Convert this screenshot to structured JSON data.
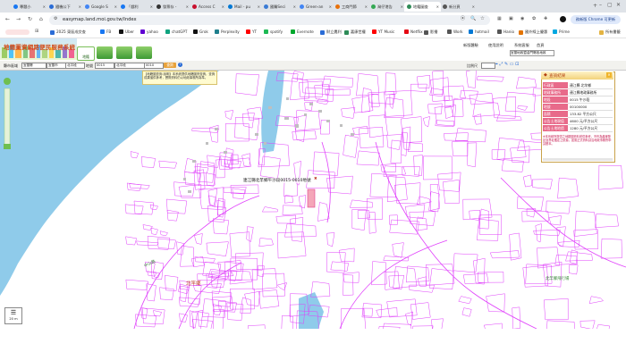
{
  "browser": {
    "tabs": [
      {
        "label": "專題小",
        "color": "#1877f2"
      },
      {
        "label": "隨機公下",
        "color": "#2a6cd6"
      },
      {
        "label": "Google S",
        "color": "#4285f4"
      },
      {
        "label": "「戲利",
        "color": "#1877f2"
      },
      {
        "label": "發票存 - ",
        "color": "#333333"
      },
      {
        "label": "Access C",
        "color": "#c8102e"
      },
      {
        "label": "Mail - pu",
        "color": "#0078d4"
      },
      {
        "label": "國醫Seci",
        "color": "#3a7bd5"
      },
      {
        "label": "Green-an",
        "color": "#4285f4"
      },
      {
        "label": "工商門節",
        "color": "#e8710a"
      },
      {
        "label": "灣仔港告",
        "color": "#34a853"
      },
      {
        "label": "地籍圖查",
        "color": "#2e8b57"
      },
      {
        "label": "新分頁",
        "color": "#555555"
      }
    ],
    "active_tab_index": 11,
    "url": "easymap.land.moi.gov.tw/Index",
    "update_button": "務新版 Chrome 可更新",
    "bookmarks": [
      {
        "label": "2025 東區成交查",
        "color": "#2a6cd6"
      },
      {
        "label": "FB",
        "color": "#1877f2"
      },
      {
        "label": "Uber",
        "color": "#111111"
      },
      {
        "label": "yahoo",
        "color": "#6001d2"
      },
      {
        "label": "chatGPT",
        "color": "#10a37f"
      },
      {
        "label": "Grok",
        "color": "#111111"
      },
      {
        "label": "Perplexity",
        "color": "#20808d"
      },
      {
        "label": "YT",
        "color": "#ff0000"
      },
      {
        "label": "spotify",
        "color": "#1db954"
      },
      {
        "label": "Evernote",
        "color": "#00a82d"
      },
      {
        "label": "財立農利",
        "color": "#2a6cd6"
      },
      {
        "label": "嘉康世權",
        "color": "#2e8b57"
      },
      {
        "label": "YT Music",
        "color": "#ff0000"
      },
      {
        "label": "Netflix",
        "color": "#e50914"
      },
      {
        "label": "影播",
        "color": "#555555"
      },
      {
        "label": "Work",
        "color": "#555555"
      },
      {
        "label": "hotmail",
        "color": "#0078d4"
      },
      {
        "label": "Hanio",
        "color": "#555555"
      },
      {
        "label": "國外線上優惠",
        "color": "#e37400"
      },
      {
        "label": "Prime",
        "color": "#00a8e1"
      }
    ],
    "all_bookmarks": "所有書籤"
  },
  "site": {
    "title": "地籍圖資網路便民服務系統",
    "nav": [
      {
        "label": "地籍",
        "selected": true
      },
      {
        "label": "",
        "selected": false
      },
      {
        "label": "",
        "selected": false
      },
      {
        "label": "",
        "selected": false
      }
    ],
    "links": [
      "新版體驗",
      "使用說明",
      "系統客服",
      "首頁"
    ],
    "site_select": "宜蘭地政暨金門縣各地政"
  },
  "query": {
    "county_label": "縣市區域",
    "county": "宜蘭縣",
    "town": "宜蘭市",
    "section_label": "地段",
    "section": "北平段",
    "number_label": "地號",
    "number": "0015",
    "number2": "0010",
    "query_button": "查詢",
    "zoom_label": "比例尺"
  },
  "map": {
    "tooltip": "【地籍圖查詢-說明】本系統提供地籍圖資查詢，查詢成果僅供參考，實際資料仍以地政事務所為準。",
    "parcel_label": "連江縣北竿鄉午沙段0015-0010地號",
    "place_label_1": "北竿鄉",
    "place_label_2": "北竿鄉飛行場",
    "road_label": "中山路",
    "scale_label": "20 m"
  },
  "panel": {
    "title": "查詢結果",
    "rows": [
      {
        "key": "行政區",
        "value": "連江縣 北竿鄉"
      },
      {
        "key": "地政事務所",
        "value": "連江縣地政事務所"
      },
      {
        "key": "地段",
        "value": "0015 午沙段"
      },
      {
        "key": "地號",
        "value": "00100000"
      },
      {
        "key": "面積",
        "value": "133.82 平方公尺"
      },
      {
        "key": "公告土地現值",
        "value": "4600 元/平方公尺"
      },
      {
        "key": "公告土地地價",
        "value": "1280 元/平方公尺"
      }
    ],
    "note": "※本系統所提供之地籍圖資料僅供參考，不作為產權登記及界址鑑定之依據，如需正式資料請洽地政事務所申請謄本。"
  },
  "colors": {
    "parcel_line": "#e040fb",
    "sea": "#7fc4e8",
    "land": "#ffffff"
  }
}
